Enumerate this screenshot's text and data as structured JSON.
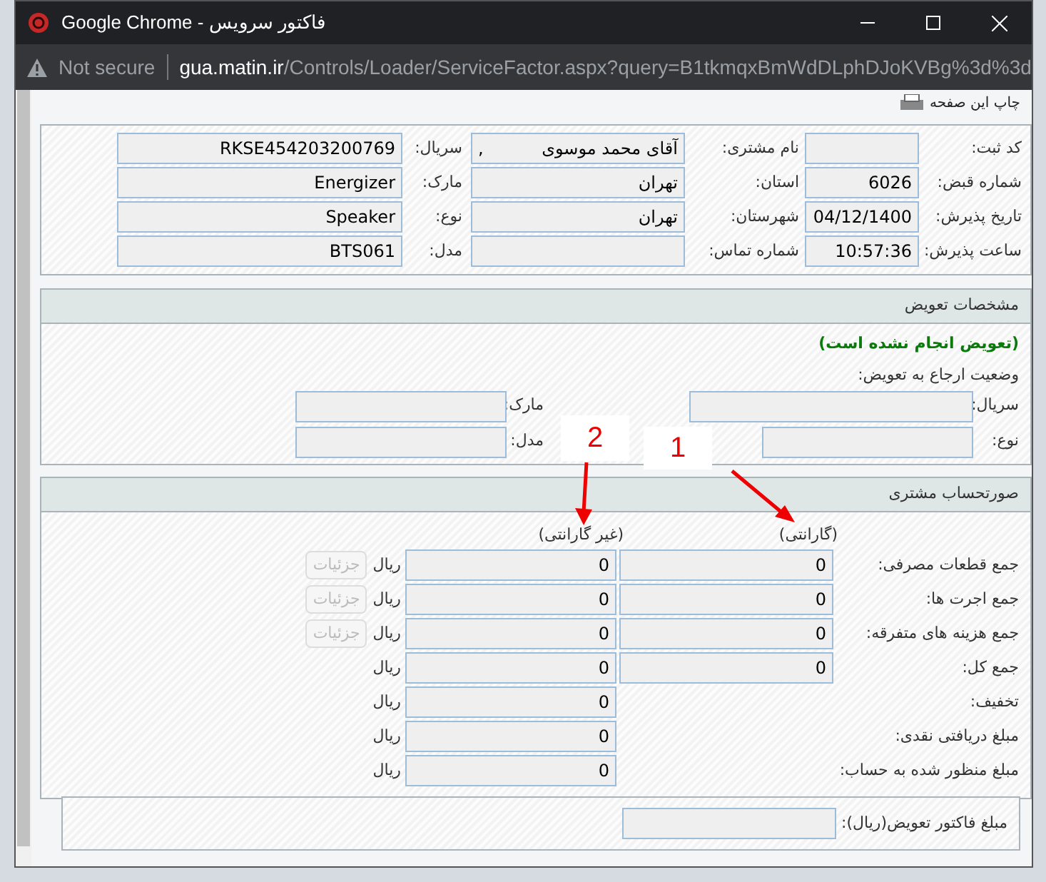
{
  "window": {
    "title": "Google Chrome - فاکتور سرویس"
  },
  "address_bar": {
    "security": "Not secure",
    "host": "gua.matin.ir",
    "path": "/Controls/Loader/ServiceFactor.aspx?query=B1tkmqxBmWdDLphDJoKVBg%3d%3d"
  },
  "print_link": "چاپ این صفحه",
  "info": {
    "rows": [
      [
        {
          "label": "کد ثبت:"
        },
        {
          "label": "نام مشتری:",
          "value": "آقای محمد موسوی",
          "suffix": ","
        },
        {
          "label": "سریال:",
          "value": "RKSE454203200769"
        }
      ],
      [
        {
          "label": "شماره قبض:",
          "value": "6026"
        },
        {
          "label": "استان:",
          "value": "تهران"
        },
        {
          "label": "مارک:",
          "value": "Energizer"
        }
      ],
      [
        {
          "label": "تاریخ پذیرش:",
          "value": "04/12/1400"
        },
        {
          "label": "شهرستان:",
          "value": "تهران"
        },
        {
          "label": "نوع:",
          "value": "Speaker"
        }
      ],
      [
        {
          "label": "ساعت پذیرش:",
          "value": "10:57:36"
        },
        {
          "label": "شماره تماس:"
        },
        {
          "label": "مدل:",
          "value": "BTS061"
        }
      ]
    ]
  },
  "replacement": {
    "title": "مشخصات تعویض",
    "status": "(تعویض انجام نشده است)",
    "referral_label": "وضعیت ارجاع به تعویض:",
    "rows": [
      [
        {
          "label": "سریال:"
        },
        {
          "label": "مارک:"
        }
      ],
      [
        {
          "label": "نوع:"
        },
        {
          "label": "مدل:"
        }
      ]
    ]
  },
  "invoice": {
    "title": "صورتحساب مشتری",
    "column_headers": [
      "(گارانتی)",
      "(غیر گارانتی)"
    ],
    "rows": [
      {
        "label": "جمع قطعات مصرفی:",
        "warranty": "0",
        "non_warranty": "0",
        "unit": "ریال",
        "details": {
          "label": "جزئیات",
          "disabled": true
        }
      },
      {
        "label": "جمع اجرت ها:",
        "warranty": "0",
        "non_warranty": "0",
        "unit": "ریال",
        "details": {
          "label": "جزئیات",
          "disabled": true
        }
      },
      {
        "label": "جمع هزینه های متفرقه:",
        "warranty": "0",
        "non_warranty": "0",
        "unit": "ریال",
        "details": {
          "label": "جزئیات",
          "disabled": true
        }
      },
      {
        "label": "جمع کل:",
        "warranty": "0",
        "non_warranty": "0",
        "unit": "ریال"
      },
      {
        "label": "تخفیف:",
        "non_warranty": "0",
        "unit": "ریال"
      },
      {
        "label": "مبلغ دریافتی نقدی:",
        "non_warranty": "0",
        "unit": "ریال"
      },
      {
        "label": "مبلغ منظور شده به حساب:",
        "non_warranty": "0",
        "unit": "ریال"
      }
    ],
    "replacement_total": {
      "label": "مبلغ فاکتور تعویض(ریال):"
    }
  },
  "annotations": [
    {
      "label": "1"
    },
    {
      "label": "2"
    }
  ]
}
